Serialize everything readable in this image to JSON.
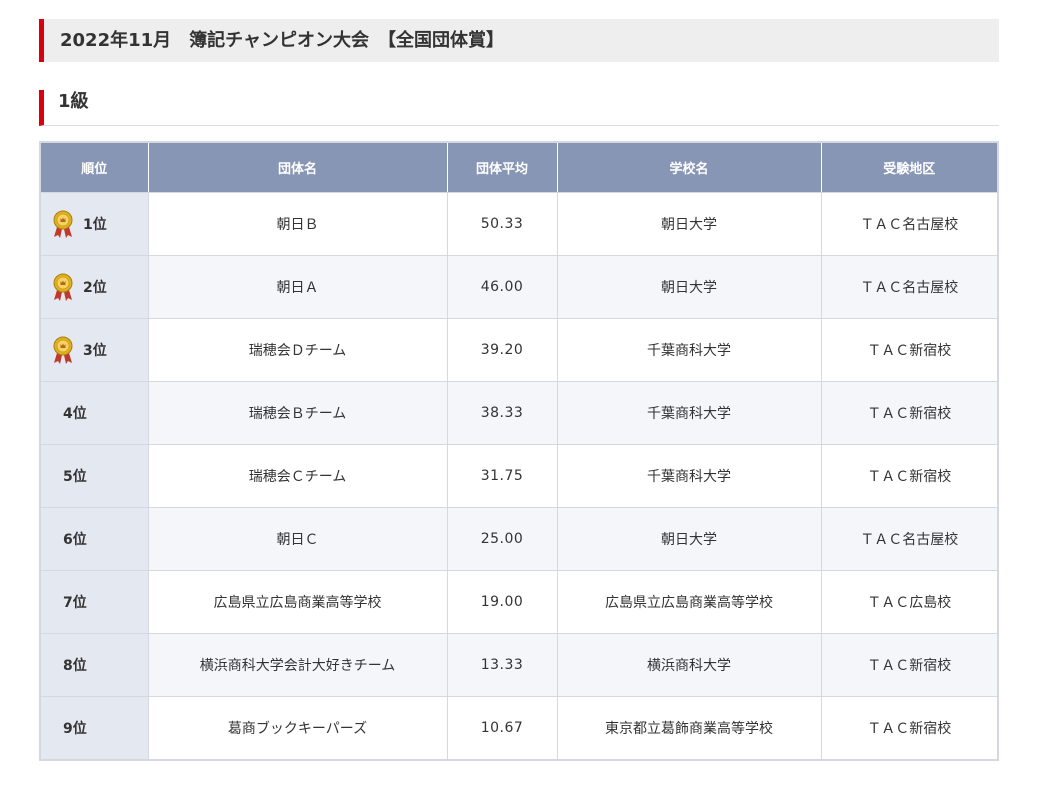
{
  "header": {
    "title": "2022年11月　簿記チャンピオン大会　【全国団体賞】"
  },
  "section": {
    "title": "1級"
  },
  "table": {
    "columns": [
      "順位",
      "団体名",
      "団体平均",
      "学校名",
      "受験地区"
    ],
    "rows": [
      {
        "rank": "1位",
        "team": "朝日Ｂ",
        "average": "50.33",
        "school": "朝日大学",
        "area": "ＴＡＣ名古屋校",
        "medal": true
      },
      {
        "rank": "2位",
        "team": "朝日Ａ",
        "average": "46.00",
        "school": "朝日大学",
        "area": "ＴＡＣ名古屋校",
        "medal": true
      },
      {
        "rank": "3位",
        "team": "瑞穂会Ｄチーム",
        "average": "39.20",
        "school": "千葉商科大学",
        "area": "ＴＡＣ新宿校",
        "medal": true
      },
      {
        "rank": "4位",
        "team": "瑞穂会Ｂチーム",
        "average": "38.33",
        "school": "千葉商科大学",
        "area": "ＴＡＣ新宿校",
        "medal": false
      },
      {
        "rank": "5位",
        "team": "瑞穂会Ｃチーム",
        "average": "31.75",
        "school": "千葉商科大学",
        "area": "ＴＡＣ新宿校",
        "medal": false
      },
      {
        "rank": "6位",
        "team": "朝日Ｃ",
        "average": "25.00",
        "school": "朝日大学",
        "area": "ＴＡＣ名古屋校",
        "medal": false
      },
      {
        "rank": "7位",
        "team": "広島県立広島商業高等学校",
        "average": "19.00",
        "school": "広島県立広島商業高等学校",
        "area": "ＴＡＣ広島校",
        "medal": false
      },
      {
        "rank": "8位",
        "team": "横浜商科大学会計大好きチーム",
        "average": "13.33",
        "school": "横浜商科大学",
        "area": "ＴＡＣ新宿校",
        "medal": false
      },
      {
        "rank": "9位",
        "team": "葛商ブックキーパーズ",
        "average": "10.67",
        "school": "東京都立葛飾商業高等学校",
        "area": "ＴＡＣ新宿校",
        "medal": false
      }
    ]
  },
  "icons": {
    "medal": "medal-icon"
  },
  "colors": {
    "accent": "#d7000f",
    "header_bg": "#8896b5",
    "rank_bg": "#e4e8f1",
    "alt_row_bg": "#f4f6fa",
    "medal_gold": "#e0b020"
  }
}
